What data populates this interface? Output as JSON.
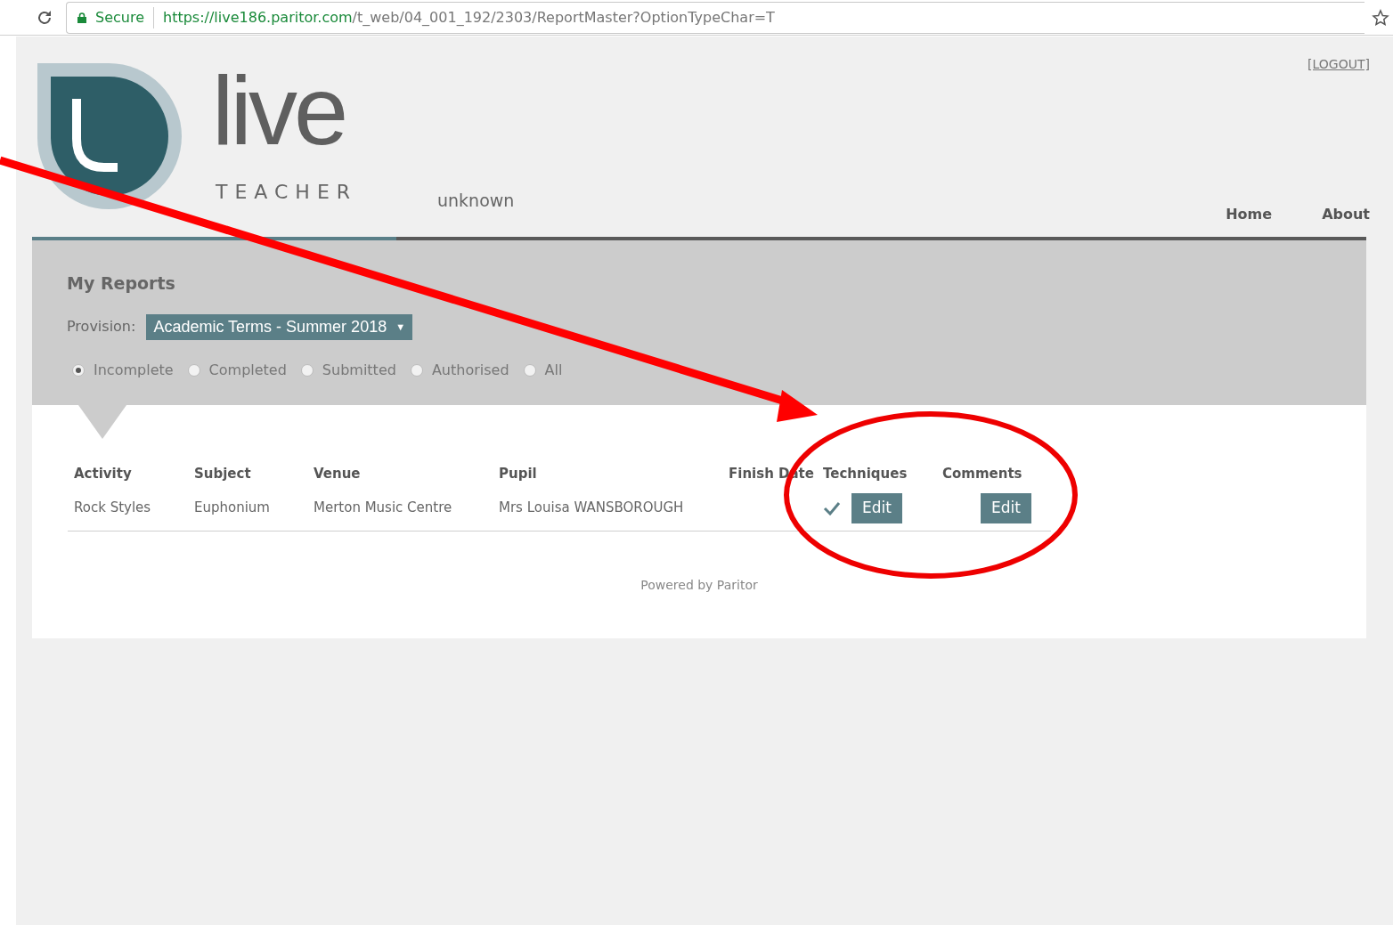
{
  "browser": {
    "security_label": "Secure",
    "url_host": "https://live186.paritor.com",
    "url_path": "/t_web/04_001_192/2303/ReportMaster?OptionTypeChar=T"
  },
  "header": {
    "logo_word": "live",
    "logo_sub": "TEACHER",
    "user": "unknown",
    "logout": "[LOGOUT]",
    "nav": [
      "Home",
      "About"
    ]
  },
  "panel": {
    "title": "My Reports",
    "provision_label": "Provision:",
    "provision_value": "Academic Terms - Summer 2018",
    "dropdown_caret": "▼",
    "filters": [
      {
        "label": "Incomplete",
        "selected": true
      },
      {
        "label": "Completed",
        "selected": false
      },
      {
        "label": "Submitted",
        "selected": false
      },
      {
        "label": "Authorised",
        "selected": false
      },
      {
        "label": "All",
        "selected": false
      }
    ]
  },
  "table": {
    "columns": [
      "Activity",
      "Subject",
      "Venue",
      "Pupil",
      "Finish Date",
      "Techniques",
      "Comments"
    ],
    "rows": [
      {
        "activity": "Rock Styles",
        "subject": "Euphonium",
        "venue": "Merton Music Centre",
        "pupil": "Mrs Louisa WANSBOROUGH",
        "techniques_done": true,
        "techniques_button": "Edit",
        "comments_button": "Edit"
      }
    ]
  },
  "footer": "Powered by Paritor"
}
